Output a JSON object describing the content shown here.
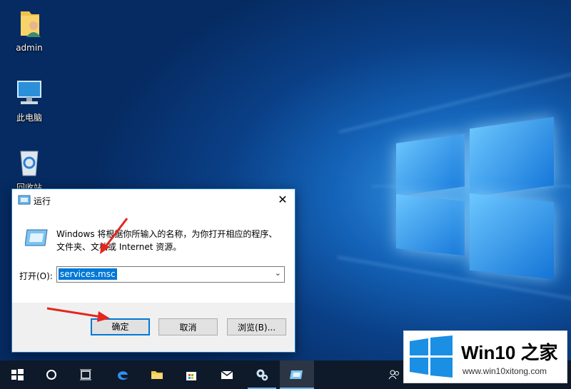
{
  "desktop": {
    "icons": [
      {
        "label": "admin",
        "icon": "user-folder-icon"
      },
      {
        "label": "此电脑",
        "icon": "computer-icon"
      },
      {
        "label": "回收站",
        "icon": "recycle-bin-icon"
      }
    ]
  },
  "run_dialog": {
    "title": "运行",
    "close_glyph": "✕",
    "description": "Windows 将根据你所输入的名称，为你打开相应的程序、文件夹、文档或 Internet 资源。",
    "open_label": "打开(O):",
    "open_value": "services.msc",
    "buttons": {
      "ok": "确定",
      "cancel": "取消",
      "browse": "浏览(B)..."
    }
  },
  "taskbar": {
    "items": [
      "start-icon",
      "cortana-icon",
      "task-view-icon",
      "edge-icon",
      "file-explorer-icon",
      "store-icon",
      "mail-icon",
      "services-icon",
      "run-icon"
    ],
    "tray_icon": "people-icon"
  },
  "watermark": {
    "title": "Win10 之家",
    "url": "www.win10xitong.com"
  },
  "colors": {
    "accent": "#0078d7",
    "arrow": "#e3261f",
    "taskbar": "#0e1a2a"
  }
}
